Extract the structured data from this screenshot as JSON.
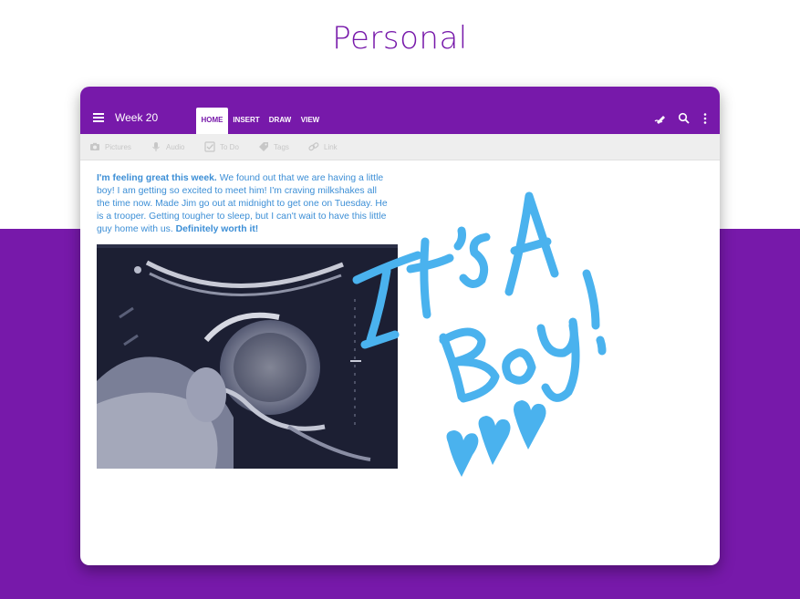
{
  "hero": {
    "title": "Personal"
  },
  "appbar": {
    "note_title": "Week 20",
    "tabs": [
      {
        "label": "HOME",
        "active": true
      },
      {
        "label": "INSERT",
        "active": false
      },
      {
        "label": "DRAW",
        "active": false
      },
      {
        "label": "VIEW",
        "active": false
      }
    ],
    "icons": [
      "hamburger-menu-icon",
      "pen-sync-icon",
      "search-icon",
      "more-vertical-icon"
    ]
  },
  "ribbon": {
    "items": [
      {
        "label": "Pictures",
        "icon": "camera-icon"
      },
      {
        "label": "Audio",
        "icon": "microphone-icon"
      },
      {
        "label": "To Do",
        "icon": "checkbox-icon"
      },
      {
        "label": "Tags",
        "icon": "tag-icon"
      },
      {
        "label": "Link",
        "icon": "link-icon"
      }
    ]
  },
  "note": {
    "intro_bold": "I'm feeling great this week.",
    "body_a": " We found out that we are having a little boy! I am getting so excited to meet him! I'm craving milkshakes all the time now. Made Jim go out at midnight to get one on Tuesday. He is a trooper. Getting tougher to sleep, but I can't wait to have this little guy home with us. ",
    "closing_bold": "Definitely worth it!"
  },
  "ink": {
    "text": "It's A Boy!",
    "color": "#4ab2ee"
  },
  "colors": {
    "brand": "#7719aa",
    "text_blue": "#3d8fd6",
    "ribbon_bg": "#eeeeee",
    "ink": "#4ab2ee"
  }
}
